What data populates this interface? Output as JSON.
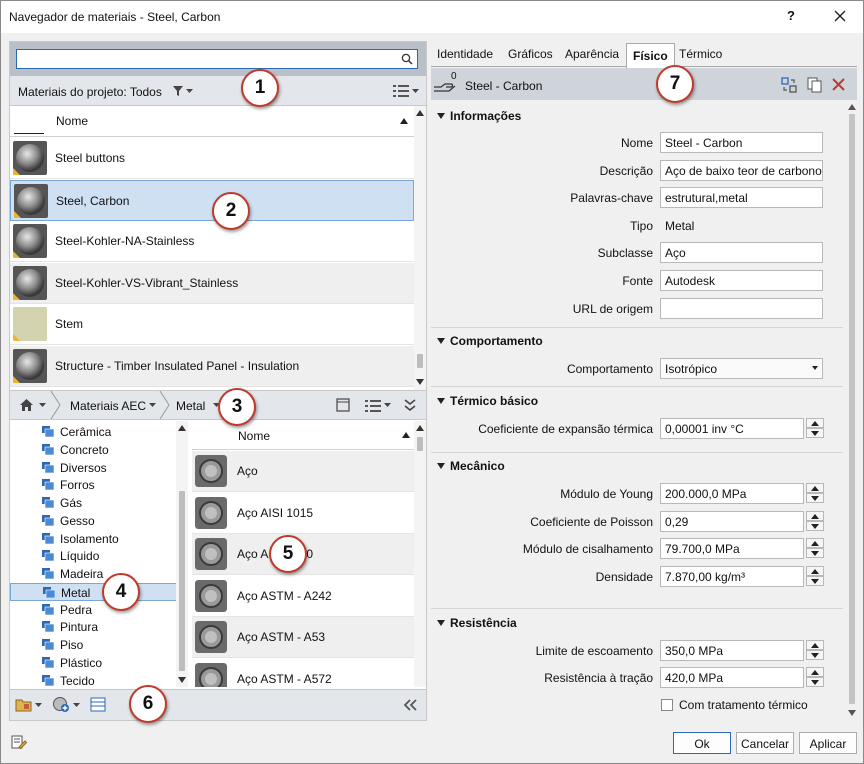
{
  "window": {
    "title": "Navegador de materiais - Steel, Carbon",
    "help": "?",
    "close": "✕"
  },
  "search": {
    "value": "",
    "placeholder": ""
  },
  "project": {
    "label": "Materiais do projeto: Todos"
  },
  "materials_header": "Nome",
  "materials": [
    {
      "name": "Steel buttons",
      "swatch": "metal"
    },
    {
      "name": "Steel, Carbon",
      "swatch": "metal"
    },
    {
      "name": "Steel-Kohler-NA-Stainless",
      "swatch": "metal"
    },
    {
      "name": "Steel-Kohler-VS-Vibrant_Stainless",
      "swatch": "metal"
    },
    {
      "name": "Stem",
      "swatch": "fabric"
    },
    {
      "name": "Structure - Timber Insulated Panel - Insulation",
      "swatch": "metal"
    }
  ],
  "library": {
    "crumbs": [
      "Materiais AEC",
      "Metal"
    ]
  },
  "tree": [
    "Cerâmica",
    "Concreto",
    "Diversos",
    "Forros",
    "Gás",
    "Gesso",
    "Isolamento",
    "Líquido",
    "Madeira",
    "Metal",
    "Pedra",
    "Pintura",
    "Piso",
    "Plástico",
    "Tecido"
  ],
  "tree_selected": "Metal",
  "assets_header": "Nome",
  "assets": [
    "Aço",
    "Aço AISI 1015",
    "Aço AISI 1020",
    "Aço ASTM - A242",
    "Aço ASTM - A53",
    "Aço ASTM - A572"
  ],
  "callouts": [
    "1",
    "2",
    "3",
    "4",
    "5",
    "6",
    "7"
  ],
  "tabs": [
    "Identidade",
    "Gráficos",
    "Aparência",
    "Físico",
    "Térmico"
  ],
  "active_tab": "Físico",
  "asset_header": {
    "count": "0",
    "name": "Steel - Carbon"
  },
  "sections": {
    "info": "Informações",
    "behavior": "Comportamento",
    "thermal": "Térmico básico",
    "mechanical": "Mecânico",
    "strength": "Resistência"
  },
  "info": {
    "name_label": "Nome",
    "name": "Steel - Carbon",
    "desc_label": "Descrição",
    "desc": "Aço de baixo teor de carbono",
    "keywords_label": "Palavras-chave",
    "keywords": "estrutural,metal",
    "type_label": "Tipo",
    "type": "Metal",
    "subclass_label": "Subclasse",
    "subclass": "Aço",
    "source_label": "Fonte",
    "source": "Autodesk",
    "url_label": "URL de origem",
    "url": ""
  },
  "behavior": {
    "label": "Comportamento",
    "value": "Isotrópico"
  },
  "thermal": {
    "label": "Coeficiente de expansão térmica",
    "value": "0,00001 inv °C"
  },
  "mechanical": {
    "young_label": "Módulo de Young",
    "young": "200.000,0 MPa",
    "poisson_label": "Coeficiente de Poisson",
    "poisson": "0,29",
    "shear_label": "Módulo de cisalhamento",
    "shear": "79.700,0 MPa",
    "density_label": "Densidade",
    "density": "7.870,00 kg/m³"
  },
  "strength": {
    "yield_label": "Limite de escoamento",
    "yield": "350,0 MPa",
    "tensile_label": "Resistência à tração",
    "tensile": "420,0 MPa",
    "heat_label": "Com tratamento térmico"
  },
  "buttons": {
    "ok": "Ok",
    "cancel": "Cancelar",
    "apply": "Aplicar"
  },
  "colors": {
    "accent": "#2a6ab5",
    "selection": "#cfe0f3",
    "callout_border": "#c0392b",
    "close_red": "#c0392b"
  }
}
